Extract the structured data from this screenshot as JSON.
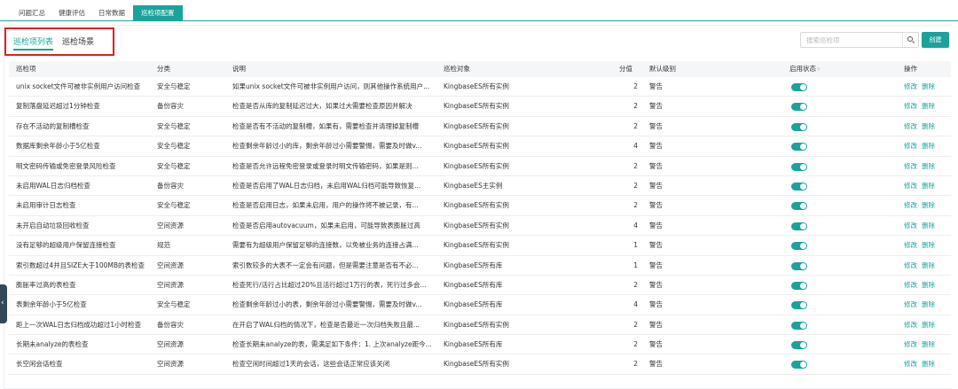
{
  "top_tabs": [
    "问题汇总",
    "健康评估",
    "日常数据",
    "巡检项配置"
  ],
  "sub_tabs": [
    "巡检项列表",
    "巡检场景"
  ],
  "search": {
    "placeholder": "搜索巡检项"
  },
  "create_label": "创建",
  "columns": {
    "item": "巡检项",
    "category": "分类",
    "description": "说明",
    "target": "巡检对象",
    "score": "分值",
    "level": "默认级别",
    "status": "启用状态",
    "action": "操作"
  },
  "actions": {
    "edit": "修改",
    "delete": "删除"
  },
  "accent_color": "#1aa39a",
  "rows": [
    {
      "item": "unix socket文件可被非实例用户访问检查",
      "category": "安全与稳定",
      "description": "如果unix socket文件可被非实例用户访问，则其他操作系统用户...",
      "target": "KingbaseES所有实例",
      "score": "2",
      "level": "警告",
      "enabled": true
    },
    {
      "item": "复制落盘延迟超过1分钟检查",
      "category": "备份容灾",
      "description": "检查是否从库的复制延迟过大，如果过大需要检查原因并解决",
      "target": "KingbaseES所有实例",
      "score": "2",
      "level": "警告",
      "enabled": true
    },
    {
      "item": "存在不活动的复制槽检查",
      "category": "安全与稳定",
      "description": "检查是否有不活动的复制槽，如果有，需要检查并清理掉复制槽",
      "target": "KingbaseES所有实例",
      "score": "2",
      "level": "警告",
      "enabled": true
    },
    {
      "item": "数据库剩余年龄小于5亿检查",
      "category": "安全与稳定",
      "description": "检查剩余年龄过小的库，剩余年龄过小需要警惕，需要及时做v...",
      "target": "KingbaseES所有实例",
      "score": "4",
      "level": "警告",
      "enabled": true
    },
    {
      "item": "明文密码传输或免密登录风险检查",
      "category": "安全与稳定",
      "description": "检查是否允许远程免密登录或登录时明文传输密码，如果是则...",
      "target": "KingbaseES所有实例",
      "score": "2",
      "level": "警告",
      "enabled": true
    },
    {
      "item": "未启用WAL日志归档检查",
      "category": "备份容灾",
      "description": "检查是否启用了WAL日志归档，未启用WAL归档可能导致恢复...",
      "target": "KingbaseES主实例",
      "score": "2",
      "level": "警告",
      "enabled": true
    },
    {
      "item": "未启用审计日志检查",
      "category": "安全与稳定",
      "description": "检查是否启用日志，如果未启用，用户的操作将不被记录，有...",
      "target": "KingbaseES所有实例",
      "score": "2",
      "level": "警告",
      "enabled": true
    },
    {
      "item": "未开启自动垃圾回收检查",
      "category": "空间资源",
      "description": "检查是否启用autovacuum，如果未启用，可能导致表膨胀过高",
      "target": "KingbaseES所有实例",
      "score": "4",
      "level": "警告",
      "enabled": true
    },
    {
      "item": "没有足够的超级用户保留连接检查",
      "category": "规范",
      "description": "需要有为超级用户保留足够的连接数，以免被业务的连接占满...",
      "target": "KingbaseES所有实例",
      "score": "1",
      "level": "警告",
      "enabled": true
    },
    {
      "item": "索引数超过4并且SIZE大于100MB的表检查",
      "category": "空间资源",
      "description": "索引数较多的大表不一定会有问题，但是需要注意是否有不必...",
      "target": "KingbaseES所有库",
      "score": "1",
      "level": "警告",
      "enabled": true
    },
    {
      "item": "膨胀率过高的表检查",
      "category": "空间资源",
      "description": "检查死行/活行占比超过20%且活行超过1万行的表，死行过多会...",
      "target": "KingbaseES所有库",
      "score": "2",
      "level": "警告",
      "enabled": true
    },
    {
      "item": "表剩余年龄小于5亿检查",
      "category": "安全与稳定",
      "description": "检查剩余年龄过小的表，剩余年龄过小需要警惕，需要及时做v...",
      "target": "KingbaseES所有库",
      "score": "4",
      "level": "警告",
      "enabled": true
    },
    {
      "item": "距上一次WAL日志归档成功超过1小时检查",
      "category": "备份容灾",
      "description": "在开启了WAL归档的情况下，检查是否最近一次归档失败且最...",
      "target": "KingbaseES所有实例",
      "score": "2",
      "level": "警告",
      "enabled": true
    },
    {
      "item": "长期未analyze的表检查",
      "category": "空间资源",
      "description": "检查长期未analyze的表，需满足如下条件：1. 上次analyze距今...",
      "target": "KingbaseES所有库",
      "score": "2",
      "level": "警告",
      "enabled": true
    },
    {
      "item": "长空闲会话检查",
      "category": "空间资源",
      "description": "检查空闲时间超过1天的会话，这些会话正常应该关闭",
      "target": "KingbaseES所有实例",
      "score": "2",
      "level": "警告",
      "enabled": true
    }
  ]
}
